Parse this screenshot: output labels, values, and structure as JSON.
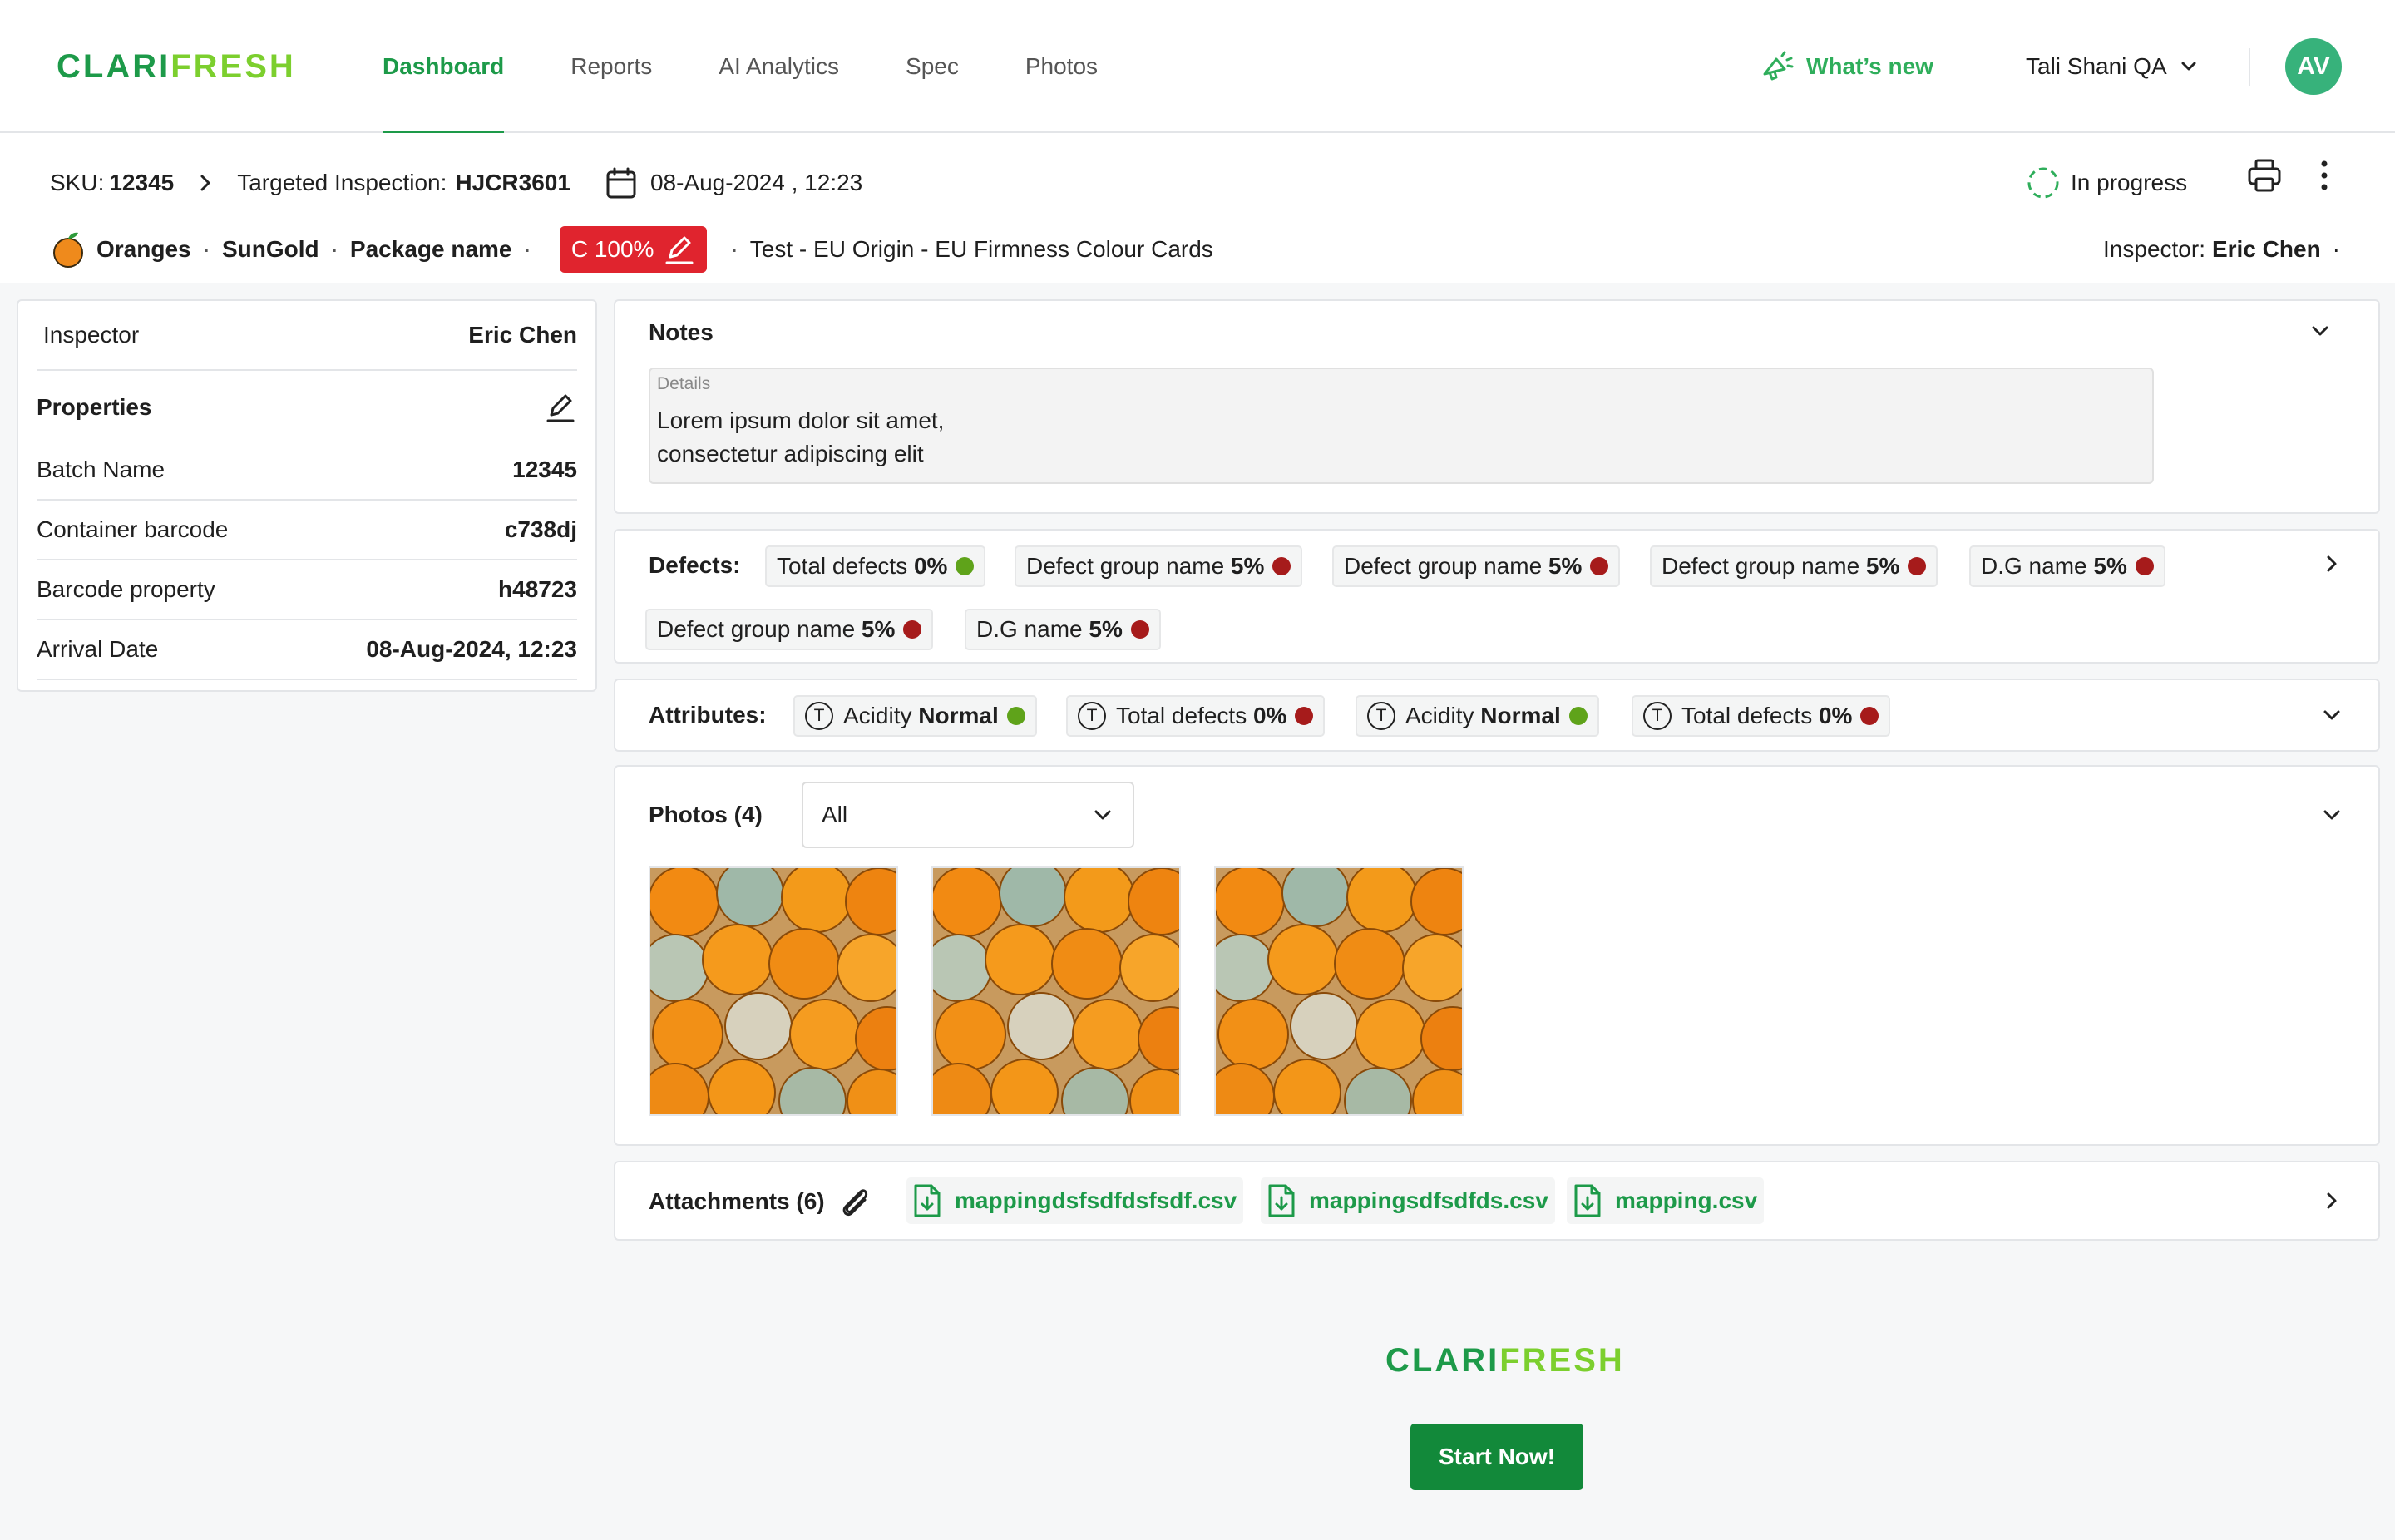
{
  "brand": {
    "logo_part1": "CLARI",
    "logo_part2": "FRESH"
  },
  "nav": {
    "tabs": [
      {
        "label": "Dashboard"
      },
      {
        "label": "Reports"
      },
      {
        "label": "AI Analytics"
      },
      {
        "label": "Spec"
      },
      {
        "label": "Photos"
      }
    ],
    "active": "Dashboard"
  },
  "header": {
    "whats_new": "What’s new",
    "user_name": "Tali Shani QA",
    "avatar_initials": "AV"
  },
  "inspection": {
    "sku_label": "SKU:",
    "sku_value": "12345",
    "type_label": "Targeted Inspection:",
    "code": "HJCR3601",
    "date": "08-Aug-2024 , 12:23",
    "status": "In progress"
  },
  "crumbs": {
    "commodity": "Oranges",
    "variety": "SunGold",
    "package": "Package name",
    "grade_badge": "C 100%",
    "spec": "Test - EU Origin - EU Firmness Colour Cards",
    "inspector_label": "Inspector:",
    "inspector_name": "Eric Chen"
  },
  "left_panel": {
    "inspector_label": "Inspector",
    "inspector_value": "Eric Chen",
    "properties_title": "Properties",
    "rows": [
      {
        "label": "Batch Name",
        "value": "12345"
      },
      {
        "label": "Container barcode",
        "value": "c738dj"
      },
      {
        "label": "Barcode property",
        "value": "h48723"
      },
      {
        "label": "Arrival Date",
        "value": "08-Aug-2024, 12:23"
      }
    ]
  },
  "notes": {
    "title": "Notes",
    "details_label": "Details",
    "line1": "Lorem ipsum dolor sit amet,",
    "line2": "consectetur adipiscing elit"
  },
  "defects": {
    "title": "Defects:",
    "chips": [
      {
        "name": "Total defects",
        "value": "0%",
        "status": "green"
      },
      {
        "name": "Defect group name",
        "value": "5%",
        "status": "red"
      },
      {
        "name": "Defect group name",
        "value": "5%",
        "status": "red"
      },
      {
        "name": "Defect group name",
        "value": "5%",
        "status": "red"
      },
      {
        "name": "D.G name",
        "value": "5%",
        "status": "red"
      },
      {
        "name": "Defect group name",
        "value": "5%",
        "status": "red"
      },
      {
        "name": "D.G name",
        "value": "5%",
        "status": "red"
      }
    ]
  },
  "attributes": {
    "title": "Attributes:",
    "type_glyph": "T",
    "chips": [
      {
        "name": "Acidity",
        "value": "Normal",
        "status": "green"
      },
      {
        "name": "Total defects",
        "value": "0%",
        "status": "red"
      },
      {
        "name": "Acidity",
        "value": "Normal",
        "status": "green"
      },
      {
        "name": "Total defects",
        "value": "0%",
        "status": "red"
      }
    ]
  },
  "photos": {
    "title": "Photos (4)",
    "filter": "All"
  },
  "attachments": {
    "title": "Attachments (6)",
    "files": [
      "mappingdsfsdfdsfsdf.csv",
      "mappingsdfsdfds.csv",
      "mapping.csv"
    ]
  },
  "footer": {
    "logo_part1": "CLARI",
    "logo_part2": "FRESH",
    "cta": "Start Now!"
  },
  "colors": {
    "brand_green": "#1d9a49",
    "accent_lime": "#7ccf2e",
    "badge_red": "#e0242e",
    "status_red": "#a61b1b",
    "status_green": "#5fa31a"
  }
}
